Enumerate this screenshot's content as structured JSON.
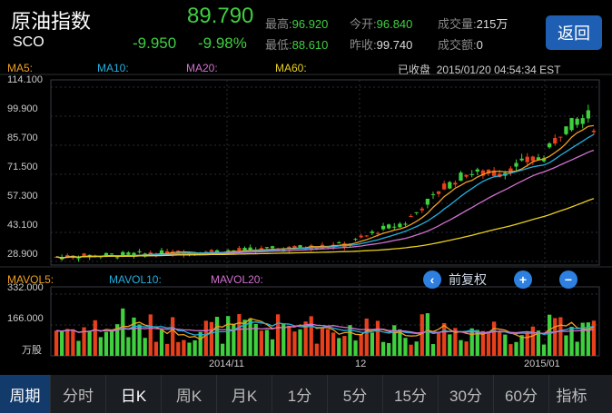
{
  "header": {
    "name": "原油指数",
    "code": "SCO",
    "price": "89.790",
    "change": "-9.950",
    "change_pct": "-9.98%",
    "high_label": "最高:",
    "high": "96.920",
    "open_label": "今开:",
    "open": "96.840",
    "volume_label": "成交量:",
    "volume": "215万",
    "low_label": "最低:",
    "low": "88.610",
    "prev_label": "昨收:",
    "prev": "99.740",
    "amount_label": "成交额:",
    "amount": "0",
    "back_label": "返回"
  },
  "ma_legend": {
    "ma5": "MA5:",
    "ma10": "MA10:",
    "ma20": "MA20:",
    "ma60": "MA60:"
  },
  "status": {
    "text": "已收盘",
    "time": "2015/01/20 04:54:34 EST"
  },
  "vol_legend": {
    "v5": "MAVOL5:",
    "v10": "MAVOL10:",
    "v20": "MAVOL20:",
    "unit": "万股"
  },
  "fq": {
    "label": "前复权"
  },
  "colors": {
    "up": "#e8401c",
    "down": "#3fcf3f",
    "ma5": "#f0a020",
    "ma10": "#22b0e0",
    "ma20": "#d070d0",
    "ma60": "#e8d020",
    "accent": "#1f5fb3"
  },
  "tabs": [
    "周期",
    "分时",
    "日K",
    "周K",
    "月K",
    "1分",
    "5分",
    "15分",
    "30分",
    "60分",
    "指标"
  ],
  "chart_data": {
    "type": "candlestick",
    "y_ticks": [
      "114.100",
      "99.900",
      "85.700",
      "71.500",
      "57.300",
      "43.100",
      "28.900"
    ],
    "ylim": [
      28.9,
      114.1
    ],
    "vol_ticks": [
      "332.000",
      "166.000"
    ],
    "vol_lim": [
      0,
      332
    ],
    "x_ticks": [
      "2014/11",
      "12",
      "2015/01"
    ]
  }
}
